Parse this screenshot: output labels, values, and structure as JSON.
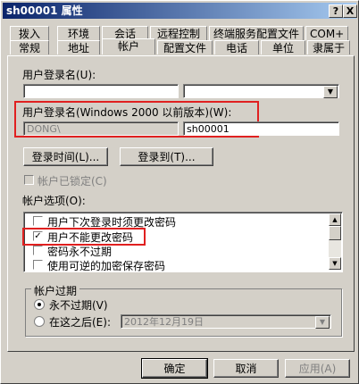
{
  "window": {
    "title": "sh00001 属性",
    "help_btn": "?",
    "close_btn": "X"
  },
  "tabs_row1": [
    "拨入",
    "环境",
    "会话",
    "远程控制",
    "终端服务配置文件",
    "COM+"
  ],
  "tabs_row2": [
    "常规",
    "地址",
    "帐户",
    "配置文件",
    "电话",
    "单位",
    "隶属于"
  ],
  "active_tab": "帐户",
  "logon": {
    "label": "用户登录名(U):",
    "name_value": "",
    "domain_value": "",
    "pre2000_label": "用户登录名(Windows 2000 以前版本)(W):",
    "pre2000_domain": "DONG\\",
    "pre2000_name": "sh00001"
  },
  "buttons": {
    "logon_hours": "登录时间(L)...",
    "logon_to": "登录到(T)..."
  },
  "account_locked": "帐户已锁定(C)",
  "account_options": {
    "label": "帐户选项(O):",
    "items": [
      {
        "label": "用户下次登录时须更改密码",
        "checked": false
      },
      {
        "label": "用户不能更改密码",
        "checked": true
      },
      {
        "label": "密码永不过期",
        "checked": false
      },
      {
        "label": "使用可逆的加密保存密码",
        "checked": false
      }
    ]
  },
  "expires": {
    "group_label": "帐户过期",
    "never": "永不过期(V)",
    "end_of": "在这之后(E):",
    "date": "2012年12月19日",
    "selected": "never"
  },
  "footer": {
    "ok": "确定",
    "cancel": "取消",
    "apply": "应用(A)"
  },
  "colors": {
    "highlight": "#e02020",
    "titlebar": "#0a246a"
  }
}
